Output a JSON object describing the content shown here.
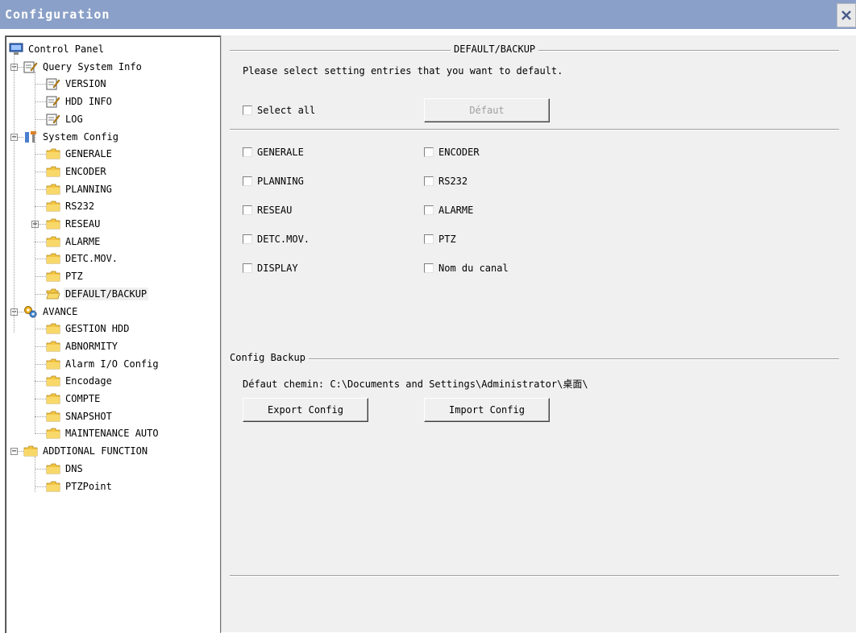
{
  "window": {
    "title": "Configuration"
  },
  "tree": {
    "items": [
      {
        "label": "Control Panel",
        "icon": "monitor-icon"
      },
      {
        "label": "Query System Info",
        "icon": "notepad-icon"
      },
      {
        "label": "VERSION",
        "icon": "notepad-icon"
      },
      {
        "label": "HDD INFO",
        "icon": "notepad-icon"
      },
      {
        "label": "LOG",
        "icon": "notepad-icon"
      },
      {
        "label": "System Config",
        "icon": "tools-icon"
      },
      {
        "label": "GENERALE",
        "icon": "folder-icon"
      },
      {
        "label": "ENCODER",
        "icon": "folder-icon"
      },
      {
        "label": "PLANNING",
        "icon": "folder-icon"
      },
      {
        "label": "RS232",
        "icon": "folder-icon"
      },
      {
        "label": "RESEAU",
        "icon": "folder-icon"
      },
      {
        "label": "ALARME",
        "icon": "folder-icon"
      },
      {
        "label": "DETC.MOV.",
        "icon": "folder-icon"
      },
      {
        "label": "PTZ",
        "icon": "folder-icon"
      },
      {
        "label": "DEFAULT/BACKUP",
        "icon": "open-folder-icon"
      },
      {
        "label": "AVANCE",
        "icon": "gears-icon"
      },
      {
        "label": "GESTION HDD",
        "icon": "folder-icon"
      },
      {
        "label": "ABNORMITY",
        "icon": "folder-icon"
      },
      {
        "label": "Alarm I/O Config",
        "icon": "folder-icon"
      },
      {
        "label": "Encodage",
        "icon": "folder-icon"
      },
      {
        "label": "COMPTE",
        "icon": "folder-icon"
      },
      {
        "label": "SNAPSHOT",
        "icon": "folder-icon"
      },
      {
        "label": "MAINTENANCE AUTO",
        "icon": "folder-icon"
      },
      {
        "label": "ADDTIONAL FUNCTION",
        "icon": "folder-icon"
      },
      {
        "label": "DNS",
        "icon": "folder-icon"
      },
      {
        "label": "PTZPoint",
        "icon": "folder-icon"
      }
    ],
    "expander_collapsed": "+",
    "expander_expanded": "−"
  },
  "default_backup": {
    "group_title": "DEFAULT/BACKUP",
    "instruction": "Please select setting entries that you want to default.",
    "select_all_label": "Select all",
    "default_button": "Défaut",
    "options": [
      {
        "label": "GENERALE",
        "checked": false
      },
      {
        "label": "ENCODER",
        "checked": false
      },
      {
        "label": "PLANNING",
        "checked": false
      },
      {
        "label": "RS232",
        "checked": false
      },
      {
        "label": "RESEAU",
        "checked": false
      },
      {
        "label": "ALARME",
        "checked": false
      },
      {
        "label": "DETC.MOV.",
        "checked": false
      },
      {
        "label": "PTZ",
        "checked": false
      },
      {
        "label": "DISPLAY",
        "checked": false
      },
      {
        "label": "Nom du canal",
        "checked": false
      }
    ]
  },
  "config_backup": {
    "group_title": "Config Backup",
    "path_text": "Défaut chemin: C:\\Documents and Settings\\Administrator\\桌面\\",
    "export_button": "Export Config",
    "import_button": "Import Config"
  },
  "colors": {
    "titlebar": "#8aa0c8",
    "panel": "#f0f0f0",
    "folder": "#f5c542"
  }
}
